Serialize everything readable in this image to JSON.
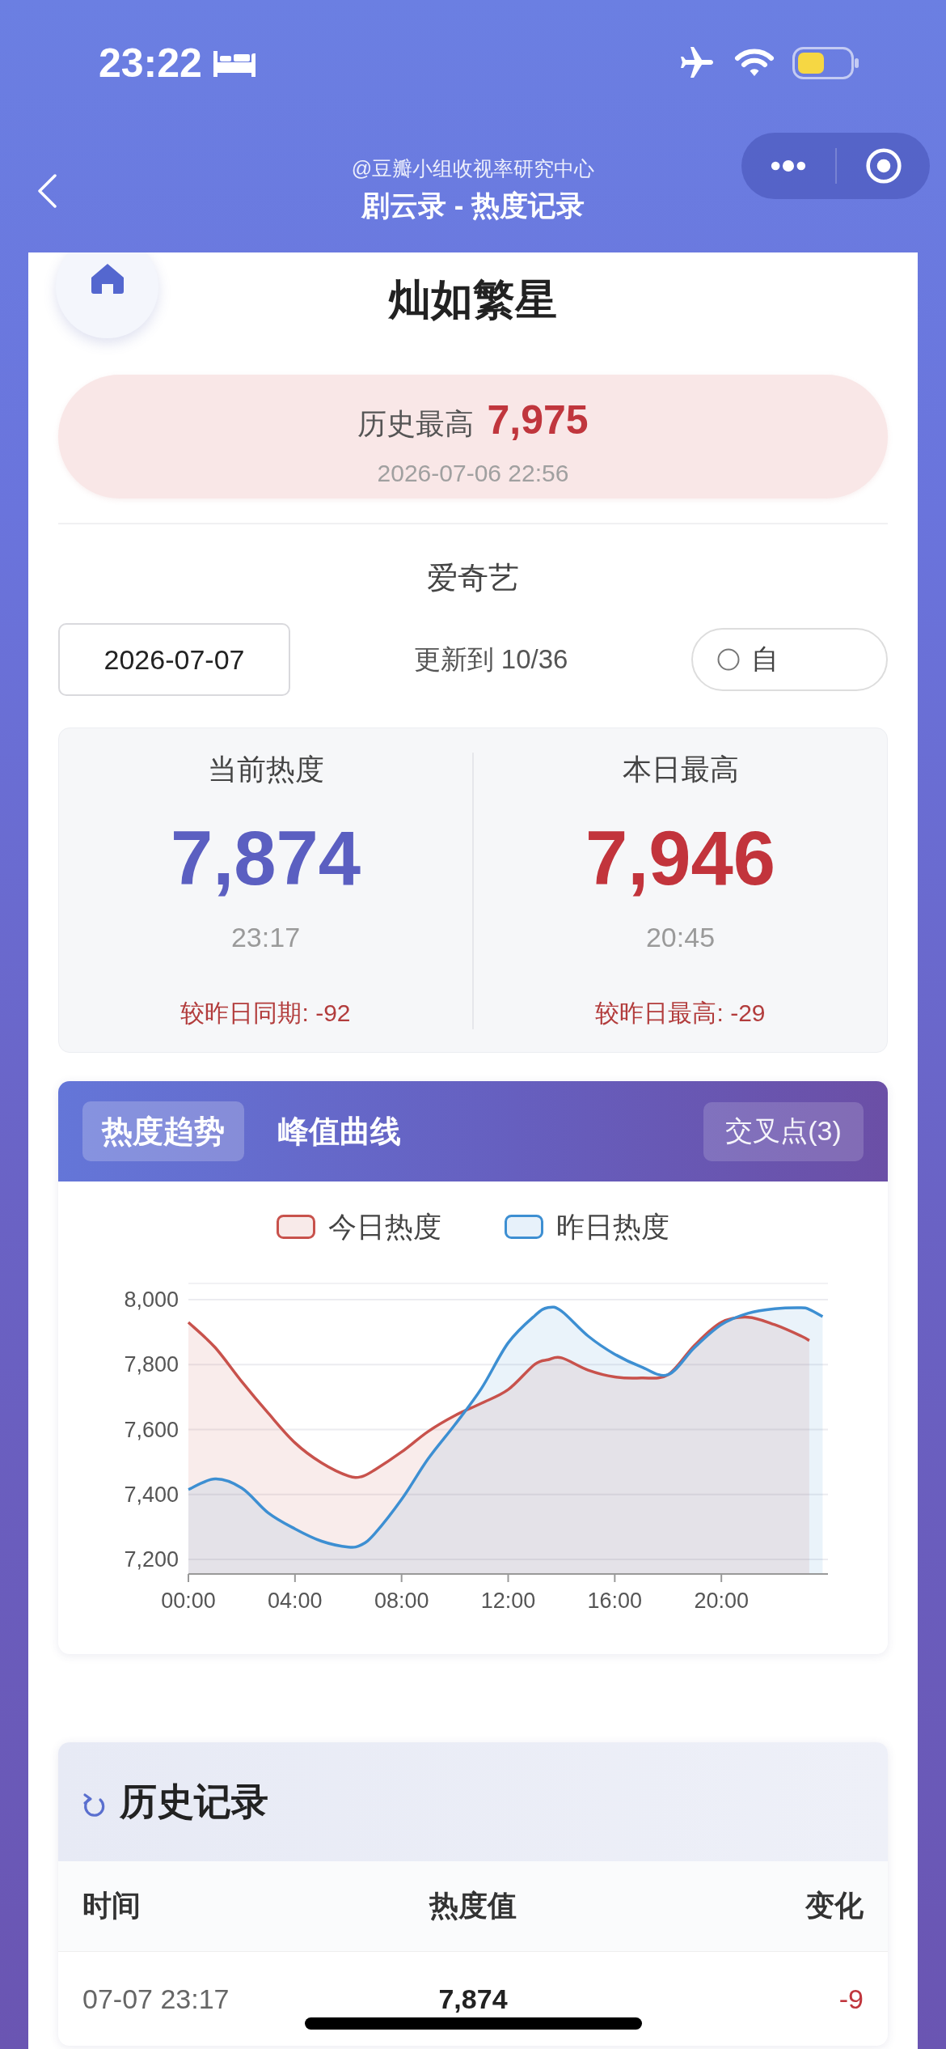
{
  "status_bar": {
    "time": "23:22"
  },
  "nav_bar": {
    "subtitle": "@豆瓣小组收视率研究中心",
    "title": "剧云录 - 热度记录"
  },
  "drama": {
    "title": "灿如繁星"
  },
  "history_high": {
    "label": "历史最高",
    "value": "7,975",
    "time": "2026-07-06 22:56"
  },
  "platform": "爱奇艺",
  "controls": {
    "date": "2026-07-07",
    "update_text": "更新到 10/36",
    "toggle": {
      "label": "自",
      "checked": false
    }
  },
  "stats": [
    {
      "kind": "current",
      "label": "当前热度",
      "value": "7,874",
      "time": "23:17",
      "compare": "较昨日同期: -92"
    },
    {
      "kind": "peak",
      "label": "本日最高",
      "value": "7,946",
      "time": "20:45",
      "compare": "较昨日最高: -29"
    }
  ],
  "chart_panel": {
    "tabs": [
      {
        "label": "热度趋势",
        "selected": true
      },
      {
        "label": "峰值曲线",
        "selected": false
      }
    ],
    "cross_button": "交叉点(3)",
    "chart_data": {
      "type": "area",
      "stacked": false,
      "grid": true,
      "x": [
        0,
        1,
        2,
        3,
        4,
        5,
        6,
        6.5,
        7,
        8,
        9,
        10,
        11,
        12,
        13,
        13.5,
        14,
        15,
        16,
        17,
        18,
        19,
        20,
        21,
        22,
        23,
        23.3,
        23.8
      ],
      "xlim": [
        0,
        24
      ],
      "ylim": [
        7155,
        8050
      ],
      "xticks": [
        {
          "value": 0,
          "label": "00:00"
        },
        {
          "value": 4,
          "label": "04:00"
        },
        {
          "value": 8,
          "label": "08:00"
        },
        {
          "value": 12,
          "label": "12:00"
        },
        {
          "value": 16,
          "label": "16:00"
        },
        {
          "value": 20,
          "label": "20:00"
        }
      ],
      "yticks": [
        {
          "value": 7200,
          "label": "7,200"
        },
        {
          "value": 7400,
          "label": "7,400"
        },
        {
          "value": 7600,
          "label": "7,600"
        },
        {
          "value": 7800,
          "label": "7,800"
        },
        {
          "value": 8000,
          "label": "8,000"
        }
      ],
      "series": [
        {
          "name": "今日热度",
          "color": "#c8524c",
          "values": [
            7930,
            7853,
            7748,
            7650,
            7559,
            7497,
            7457,
            7455,
            7476,
            7531,
            7594,
            7643,
            7681,
            7723,
            7801,
            7815,
            7821,
            7783,
            7762,
            7759,
            7769,
            7860,
            7930,
            7946,
            7923,
            7888,
            7874,
            null
          ]
        },
        {
          "name": "昨日热度",
          "color": "#3d8fd2",
          "values": [
            7415,
            7448,
            7420,
            7343,
            7294,
            7256,
            7238,
            7245,
            7280,
            7385,
            7510,
            7615,
            7727,
            7867,
            7951,
            7976,
            7965,
            7888,
            7832,
            7793,
            7769,
            7853,
            7923,
            7958,
            7972,
            7975,
            7970,
            7948
          ]
        }
      ]
    }
  },
  "history": {
    "title": "历史记录",
    "columns": [
      "时间",
      "热度值",
      "变化"
    ],
    "rows": [
      {
        "time": "07-07 23:17",
        "value": "7,874",
        "change": "-9"
      }
    ]
  }
}
